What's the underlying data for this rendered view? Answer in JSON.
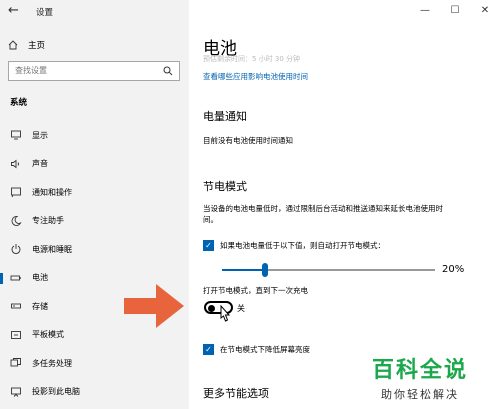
{
  "window": {
    "title": "设置",
    "controls": {
      "minimize": "—",
      "maximize": "☐",
      "close": "✕"
    }
  },
  "sidebar": {
    "back": "←",
    "home": "主页",
    "search_placeholder": "查找设置",
    "section": "系统",
    "items": [
      {
        "label": "显示",
        "icon": "display-icon"
      },
      {
        "label": "声音",
        "icon": "speaker-icon"
      },
      {
        "label": "通知和操作",
        "icon": "notification-icon"
      },
      {
        "label": "专注助手",
        "icon": "moon-icon"
      },
      {
        "label": "电源和睡眠",
        "icon": "power-icon"
      },
      {
        "label": "电池",
        "icon": "battery-icon"
      },
      {
        "label": "存储",
        "icon": "storage-icon"
      },
      {
        "label": "平板模式",
        "icon": "tablet-icon"
      },
      {
        "label": "多任务处理",
        "icon": "multitask-icon"
      },
      {
        "label": "投影到此电脑",
        "icon": "project-icon"
      }
    ],
    "active_index": 5
  },
  "main": {
    "title": "电池",
    "faded_line": "预估剩余时间：5 小时 30 分钟",
    "link": "查看哪些应用影响电池使用时间",
    "notice_heading": "电量通知",
    "notice_text": "目前没有电池使用时间通知",
    "saver_heading": "节电模式",
    "saver_desc_1": "当设备的电池电量低时，通过限制后台活动和推送通知来延长电池使用时",
    "saver_desc_2": "间。",
    "auto_checkbox": {
      "checked": true,
      "label": "如果电池电量低于以下值，则自动打开节电模式："
    },
    "slider": {
      "value": "20%",
      "fraction": 0.2
    },
    "until_charge": "打开节电模式，直到下一次充电",
    "toggle": {
      "on": false,
      "label": "关"
    },
    "brightness_checkbox": {
      "checked": true,
      "label": "在节电模式下降低屏幕亮度"
    },
    "more_heading": "更多节能选项"
  },
  "watermark": {
    "big": "百科全说",
    "small": "助你轻松解决"
  },
  "colors": {
    "accent": "#0063b1",
    "arrow": "#e8643c",
    "sidebar_bg": "#f2f2f2",
    "watermark_green": "#1ba84c"
  }
}
